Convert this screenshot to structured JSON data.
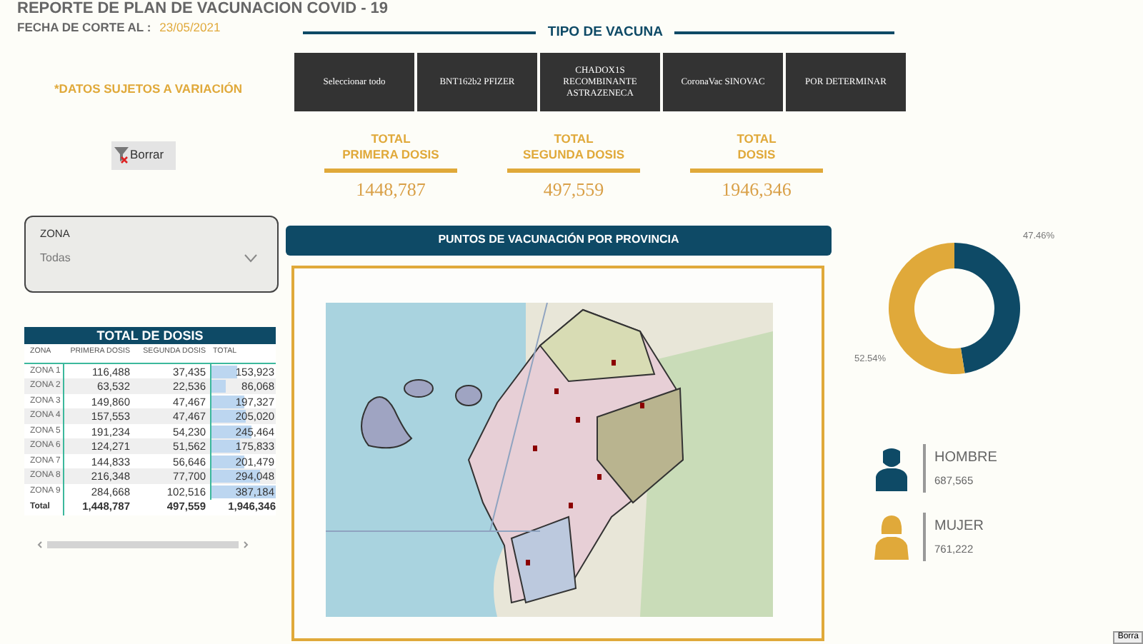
{
  "report_title": "REPORTE DE PLAN DE VACUNACION COVID - 19",
  "cutoff": {
    "label": "FECHA DE CORTE AL :",
    "date": "23/05/2021"
  },
  "disclaimer": "*DATOS SUJETOS A VARIACIÓN",
  "clear_button": "Borrar",
  "zone_filter": {
    "label": "ZONA",
    "value": "Todas"
  },
  "dose_table": {
    "title": "TOTAL DE DOSIS",
    "columns": [
      "ZONA",
      "PRIMERA DOSIS",
      "SEGUNDA DOSIS",
      "TOTAL"
    ],
    "rows": [
      {
        "zona": "ZONA 1",
        "primera": "116,488",
        "segunda": "37,435",
        "total": "153,923",
        "level": 0.4
      },
      {
        "zona": "ZONA 2",
        "primera": "63,532",
        "segunda": "22,536",
        "total": "86,068",
        "level": 0.22
      },
      {
        "zona": "ZONA 3",
        "primera": "149,860",
        "segunda": "47,467",
        "total": "197,327",
        "level": 0.51
      },
      {
        "zona": "ZONA 4",
        "primera": "157,553",
        "segunda": "47,467",
        "total": "205,020",
        "level": 0.53
      },
      {
        "zona": "ZONA 5",
        "primera": "191,234",
        "segunda": "54,230",
        "total": "245,464",
        "level": 0.63
      },
      {
        "zona": "ZONA 6",
        "primera": "124,271",
        "segunda": "51,562",
        "total": "175,833",
        "level": 0.45
      },
      {
        "zona": "ZONA 7",
        "primera": "144,833",
        "segunda": "56,646",
        "total": "201,479",
        "level": 0.52
      },
      {
        "zona": "ZONA 8",
        "primera": "216,348",
        "segunda": "77,700",
        "total": "294,048",
        "level": 0.76
      },
      {
        "zona": "ZONA 9",
        "primera": "284,668",
        "segunda": "102,516",
        "total": "387,184",
        "level": 1
      }
    ],
    "total_row": {
      "zona": "Total",
      "primera": "1,448,787",
      "segunda": "497,559",
      "total": "1,946,346"
    }
  },
  "vaccine_type": {
    "title": "TIPO DE VACUNA",
    "options": [
      {
        "label": "Seleccionar todo",
        "selected": false
      },
      {
        "label": "BNT162b2 PFIZER",
        "selected": false
      },
      {
        "label": "CHADOX1S RECOMBINANTE ASTRAZENECA",
        "selected": false
      },
      {
        "label": "CoronaVac SINOVAC",
        "selected": false
      },
      {
        "label": "POR DETERMINAR",
        "selected": false
      }
    ]
  },
  "totals": [
    {
      "label_line1": "TOTAL",
      "label_line2": "PRIMERA DOSIS",
      "value": "1448,787"
    },
    {
      "label_line1": "TOTAL",
      "label_line2": "SEGUNDA DOSIS",
      "value": "497,559"
    },
    {
      "label_line1": "TOTAL",
      "label_line2": "DOSIS",
      "value": "1946,346"
    }
  ],
  "map_section": {
    "title": "PUNTOS DE VACUNACIÓN POR PROVINCIA"
  },
  "gender_chart": {
    "chart_data": {
      "type": "donut",
      "values": [
        47.46,
        52.54
      ],
      "colors": [
        "#0e4a66",
        "#e0a93a"
      ],
      "value_labels": [
        "47.46%",
        "52.54%"
      ]
    }
  },
  "gender_cards": [
    {
      "kind": "male",
      "label": "HOMBRE",
      "value": "687,565",
      "color": "#0e4a66"
    },
    {
      "kind": "female",
      "label": "MUJER",
      "value": "761,222",
      "color": "#e0a93a"
    }
  ],
  "corner_tag": "Borra"
}
